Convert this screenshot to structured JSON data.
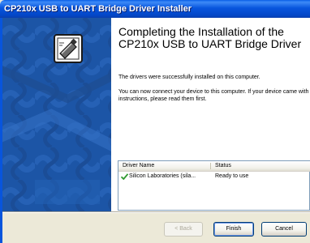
{
  "window": {
    "title": "CP210x USB to UART Bridge Driver Installer"
  },
  "colors": {
    "titlebar": "#0855dd",
    "sidepanel": "#1c55a6",
    "dialog_bg": "#ece9d8",
    "check": "#2f9a2f"
  },
  "wizard": {
    "icon": "usb-device-icon",
    "heading": "Completing the Installation of the CP210x USB to UART Bridge Driver",
    "message1": "The drivers were successfully installed on this computer.",
    "message2": "You can now connect your device to this computer. If your device came with instructions, please read them first."
  },
  "driver_list": {
    "columns": [
      "Driver Name",
      "Status"
    ],
    "rows": [
      {
        "icon": "check-icon",
        "name": "Silicon Laboratories (sila...",
        "status": "Ready to use"
      }
    ]
  },
  "buttons": {
    "back": "< Back",
    "finish": "Finish",
    "cancel": "Cancel"
  }
}
